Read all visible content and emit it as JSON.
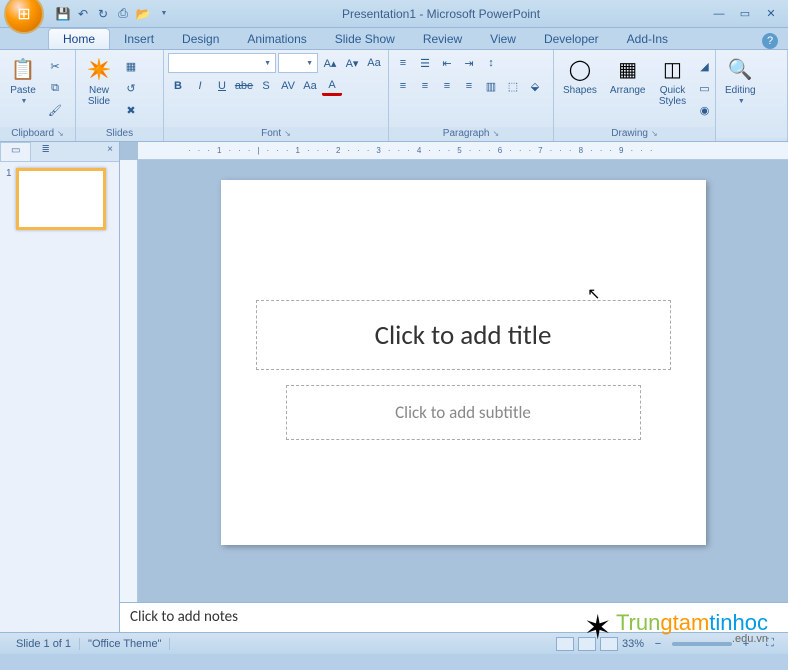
{
  "title": "Presentation1 - Microsoft PowerPoint",
  "tabs": [
    "Home",
    "Insert",
    "Design",
    "Animations",
    "Slide Show",
    "Review",
    "View",
    "Developer",
    "Add-Ins"
  ],
  "active_tab": 0,
  "ribbon": {
    "clipboard": {
      "label": "Clipboard",
      "paste": "Paste"
    },
    "slides": {
      "label": "Slides",
      "new_slide": "New\nSlide"
    },
    "font": {
      "label": "Font",
      "name_placeholder": "",
      "size_placeholder": ""
    },
    "paragraph": {
      "label": "Paragraph"
    },
    "drawing": {
      "label": "Drawing",
      "shapes": "Shapes",
      "arrange": "Arrange",
      "quick_styles": "Quick\nStyles"
    },
    "editing": {
      "label": "Editing",
      "editing": "Editing"
    }
  },
  "slide": {
    "title_placeholder": "Click to add title",
    "subtitle_placeholder": "Click to add subtitle"
  },
  "notes_placeholder": "Click to add notes",
  "status": {
    "slide": "Slide 1 of 1",
    "theme": "\"Office Theme\"",
    "zoom": "33%"
  },
  "thumb_number": "1",
  "watermark": {
    "text": "Trungtamtinhoc",
    "sub": ".edu.vn"
  },
  "ruler": "···1···|···1···2···3···4···5···6···7···8···9···"
}
